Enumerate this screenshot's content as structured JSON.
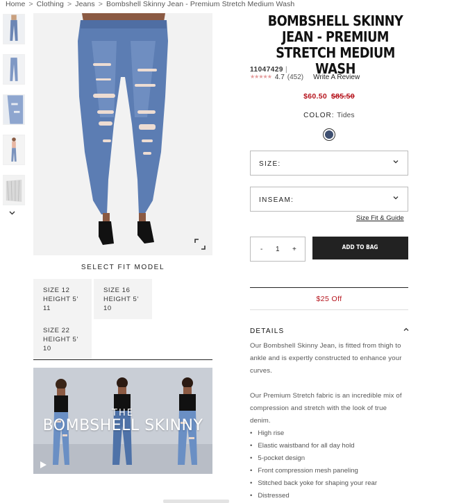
{
  "breadcrumb": {
    "items": [
      "Home",
      "Clothing",
      "Jeans",
      "Bombshell Skinny Jean - Premium Stretch Medium Wash"
    ],
    "separator": ">"
  },
  "gallery": {
    "thumbnails": [
      "thumbnail-1",
      "thumbnail-2",
      "thumbnail-3",
      "thumbnail-4",
      "thumbnail-5"
    ],
    "down_arrow_icon": "chevron-down-icon",
    "expand_icon": "expand-icon"
  },
  "fit_models": {
    "heading": "SELECT FIT MODEL",
    "models": [
      {
        "size": "SIZE  12",
        "height": "HEIGHT  5'",
        "inches": "11"
      },
      {
        "size": "SIZE  16",
        "height": "HEIGHT  5'",
        "inches": "10"
      },
      {
        "size": "SIZE  22",
        "height": "HEIGHT  5'",
        "inches": "10"
      }
    ]
  },
  "video": {
    "title_small": "THE",
    "title_big": "BOMBSHELL SKINNY",
    "play_icon": "play-icon"
  },
  "product": {
    "title": "BOMBSHELL SKINNY JEAN - PREMIUM STRETCH MEDIUM WASH",
    "sku": "11047429",
    "sku_separator": "|",
    "stars": "★★★★★",
    "rating": "4.7",
    "review_count": "(452)",
    "write_review": "Write A Review",
    "price_sale": "$60.50",
    "price_original": "$85.50",
    "color_label": "COLOR:",
    "color_value": "Tides",
    "swatch_color": "#3e4f70",
    "size_label": "SIZE:",
    "inseam_label": "INSEAM:",
    "size_guide": "Size Fit & Guide",
    "qty_minus": "-",
    "qty_value": "1",
    "qty_plus": "+",
    "add_to_bag": "ADD TO BAG",
    "promo": "$25 Off"
  },
  "details": {
    "heading": "DETAILS",
    "paragraph1": "Our Bombshell Skinny Jean, is fitted from thigh to ankle and is expertly constructed to enhance your curves.",
    "paragraph2": "Our Premium Stretch fabric is an incredible mix of compression and stretch with the look of true denim.",
    "bullets": [
      "High rise",
      "Elastic waistband for all day hold",
      "5-pocket design",
      "Front compression mesh paneling",
      "Stitched back yoke for shaping your rear",
      "Distressed"
    ]
  },
  "colors": {
    "accent_red": "#b5121b",
    "button_dark": "#222222",
    "star_pink": "#e39b9b"
  }
}
